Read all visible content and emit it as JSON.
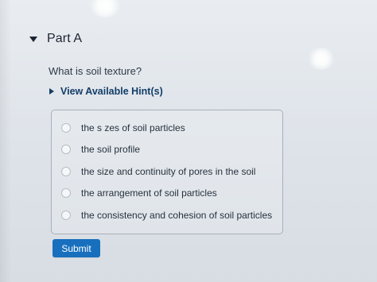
{
  "part": {
    "title": "Part A",
    "expand_icon": "caret-down-icon"
  },
  "question": {
    "text": "What is soil texture?"
  },
  "hint": {
    "label": "View Available Hint(s)",
    "icon": "caret-right-icon"
  },
  "answers": {
    "options": [
      "the s zes of soil particles",
      "the soil profile",
      "the size and continuity of pores in the soil",
      "the arrangement of soil particles",
      "the consistency and cohesion of soil particles"
    ]
  },
  "actions": {
    "submit_label": "Submit"
  },
  "colors": {
    "accent": "#176fbe",
    "link": "#123d67",
    "border": "#a7afb8"
  }
}
